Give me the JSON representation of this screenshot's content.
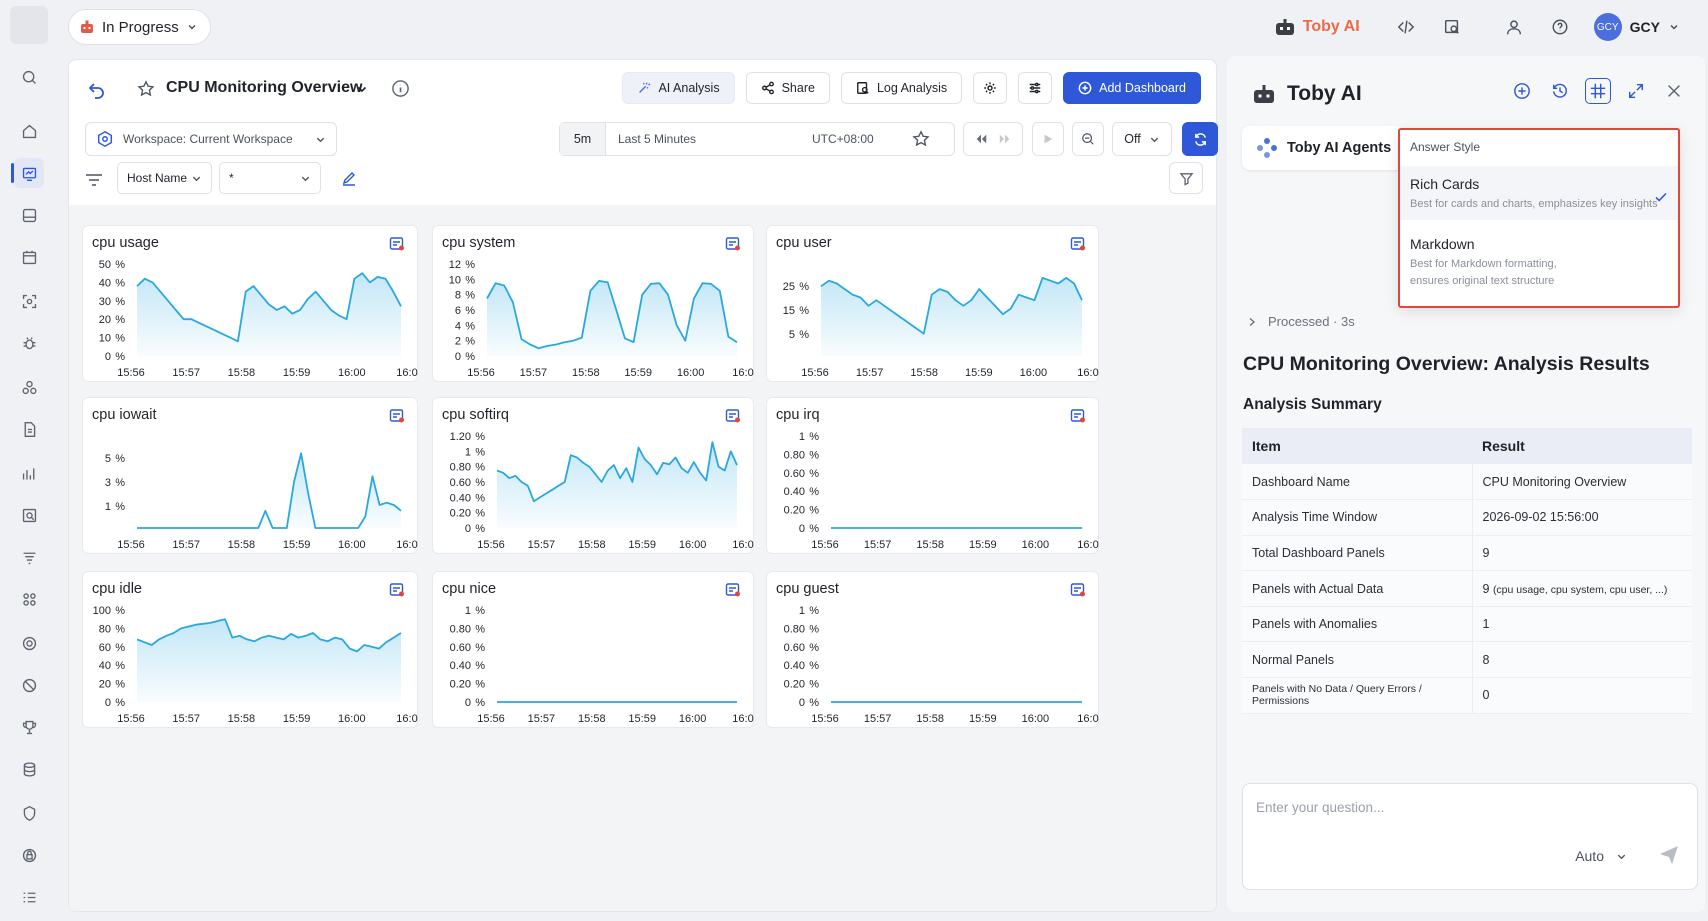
{
  "topbar": {
    "status_label": "In Progress",
    "brand": "Toby AI",
    "user_initials": "GCY",
    "user_name": "GCY"
  },
  "dashboard": {
    "title": "CPU Monitoring Overview",
    "buttons": {
      "ai_analysis": "AI Analysis",
      "share": "Share",
      "log_analysis": "Log Analysis",
      "add_dashboard": "Add Dashboard"
    },
    "workspace": "Workspace: Current Workspace",
    "time": {
      "quick": "5m",
      "range": "Last 5 Minutes",
      "timezone": "UTC+08:00",
      "auto_refresh": "Off"
    },
    "variable": {
      "name": "Host Name",
      "value": "*"
    }
  },
  "colors": {
    "accent": "#2f58d8",
    "series": "#29a8df",
    "brand": "#ea6b45",
    "highlight": "#e0463c"
  },
  "panels": [
    {
      "title": "cpu usage"
    },
    {
      "title": "cpu system"
    },
    {
      "title": "cpu user"
    },
    {
      "title": "cpu iowait"
    },
    {
      "title": "cpu softirq"
    },
    {
      "title": "cpu irq"
    },
    {
      "title": "cpu idle"
    },
    {
      "title": "cpu nice"
    },
    {
      "title": "cpu guest"
    }
  ],
  "chart_data": [
    {
      "type": "area",
      "name": "cpu usage",
      "x": [
        "15:56",
        "15:57",
        "15:58",
        "15:59",
        "16:00",
        "16:0"
      ],
      "y_ticks": [
        "50 %",
        "40 %",
        "30 %",
        "20 %",
        "10 %",
        "0 %"
      ],
      "ylim": [
        0,
        50
      ],
      "values": [
        38,
        42,
        40,
        35,
        30,
        25,
        20,
        20,
        18,
        16,
        14,
        12,
        10,
        8,
        35,
        38,
        33,
        28,
        25,
        27,
        23,
        25,
        31,
        35,
        30,
        25,
        22,
        20,
        42,
        45,
        40,
        43,
        42,
        35,
        27
      ]
    },
    {
      "type": "area",
      "name": "cpu system",
      "x": [
        "15:56",
        "15:57",
        "15:58",
        "15:59",
        "16:00",
        "16:0"
      ],
      "y_ticks": [
        "12 %",
        "10 %",
        "8 %",
        "6 %",
        "4 %",
        "2 %",
        "0 %"
      ],
      "ylim": [
        0,
        12
      ],
      "values": [
        7.5,
        9.5,
        9.2,
        7,
        2.2,
        1.5,
        1,
        1.3,
        1.5,
        1.8,
        2,
        2.4,
        8.5,
        9.8,
        9.6,
        6,
        2.3,
        1.8,
        8,
        9.4,
        9.5,
        8,
        4,
        2,
        7.5,
        9.5,
        9.4,
        8.5,
        2.5,
        1.8
      ]
    },
    {
      "type": "area",
      "name": "cpu user",
      "x": [
        "15:56",
        "15:57",
        "15:58",
        "15:59",
        "16:00",
        "16:0"
      ],
      "y_ticks": [
        "25 %",
        "15 %",
        "5 %"
      ],
      "ylim": [
        0,
        33
      ],
      "values": [
        25,
        27,
        26,
        24,
        22,
        21,
        18,
        20,
        18,
        16,
        14,
        12,
        10,
        8,
        22,
        24,
        23,
        20,
        18,
        20,
        24,
        21,
        18,
        15,
        17,
        22,
        21,
        20,
        28,
        27,
        26,
        28,
        26,
        20
      ]
    },
    {
      "type": "area",
      "name": "cpu iowait",
      "x": [
        "15:56",
        "15:57",
        "15:58",
        "15:59",
        "16:00",
        "16:0"
      ],
      "y_ticks": [
        "5 %",
        "3 %",
        "1 %"
      ],
      "ylim": [
        0,
        8
      ],
      "values": [
        0,
        0,
        0,
        0,
        0,
        0,
        0,
        0,
        0,
        0,
        0,
        0,
        0,
        0,
        0,
        0,
        0,
        0,
        1.5,
        0,
        0,
        0,
        4,
        6.5,
        3,
        0,
        0,
        0,
        0,
        0,
        0,
        0,
        1,
        4.5,
        2,
        2.2,
        2,
        1.5
      ]
    },
    {
      "type": "area",
      "name": "cpu softirq",
      "x": [
        "15:56",
        "15:57",
        "15:58",
        "15:59",
        "16:00",
        "16:0"
      ],
      "y_ticks": [
        "1.20 %",
        "1 %",
        "0.80 %",
        "0.60 %",
        "0.40 %",
        "0.20 %",
        "0 %"
      ],
      "ylim": [
        0,
        1.2
      ],
      "values": [
        0.75,
        0.72,
        0.65,
        0.68,
        0.6,
        0.55,
        0.35,
        0.4,
        0.45,
        0.5,
        0.55,
        0.6,
        0.95,
        0.92,
        0.85,
        0.8,
        0.7,
        0.6,
        0.75,
        0.82,
        0.65,
        0.78,
        0.6,
        1.05,
        0.9,
        0.82,
        0.7,
        0.85,
        0.83,
        0.92,
        0.78,
        0.72,
        0.86,
        0.72,
        0.62,
        1.12,
        0.8,
        0.75,
        1.0,
        0.82
      ]
    },
    {
      "type": "line",
      "name": "cpu irq",
      "x": [
        "15:56",
        "15:57",
        "15:58",
        "15:59",
        "16:00",
        "16:0"
      ],
      "y_ticks": [
        "1 %",
        "0.80 %",
        "0.60 %",
        "0.40 %",
        "0.20 %",
        "0 %"
      ],
      "ylim": [
        0,
        1
      ],
      "values": [
        0,
        0
      ]
    },
    {
      "type": "area",
      "name": "cpu idle",
      "x": [
        "15:56",
        "15:57",
        "15:58",
        "15:59",
        "16:00",
        "16:0"
      ],
      "y_ticks": [
        "100 %",
        "80 %",
        "60 %",
        "40 %",
        "20 %",
        "0 %"
      ],
      "ylim": [
        0,
        100
      ],
      "values": [
        68,
        65,
        62,
        68,
        72,
        75,
        80,
        82,
        84,
        85,
        86,
        88,
        90,
        70,
        72,
        68,
        66,
        70,
        72,
        70,
        68,
        74,
        70,
        72,
        75,
        68,
        66,
        70,
        68,
        58,
        55,
        62,
        60,
        58,
        65,
        70,
        75
      ]
    },
    {
      "type": "line",
      "name": "cpu nice",
      "x": [
        "15:56",
        "15:57",
        "15:58",
        "15:59",
        "16:00",
        "16:0"
      ],
      "y_ticks": [
        "1 %",
        "0.80 %",
        "0.60 %",
        "0.40 %",
        "0.20 %",
        "0 %"
      ],
      "ylim": [
        0,
        1
      ],
      "values": [
        0,
        0
      ]
    },
    {
      "type": "line",
      "name": "cpu guest",
      "x": [
        "15:56",
        "15:57",
        "15:58",
        "15:59",
        "16:00",
        "16:0"
      ],
      "y_ticks": [
        "1 %",
        "0.80 %",
        "0.60 %",
        "0.40 %",
        "0.20 %",
        "0 %"
      ],
      "ylim": [
        0,
        1
      ],
      "values": [
        0,
        0
      ]
    }
  ],
  "ai": {
    "title": "Toby AI",
    "agents_label": "Toby AI Agents",
    "answer_style": {
      "label": "Answer Style",
      "options": [
        {
          "name": "Rich Cards",
          "desc": "Best for cards and charts, emphasizes key insights",
          "selected": true
        },
        {
          "name": "Markdown",
          "desc1": "Best for Markdown formatting,",
          "desc2": "ensures original text structure",
          "selected": false
        }
      ]
    },
    "processed": "Processed · 3s",
    "result_title": "CPU Monitoring Overview: Analysis Results",
    "summary_title": "Analysis Summary",
    "table_headers": {
      "item": "Item",
      "result": "Result"
    },
    "rows": [
      {
        "item": "Dashboard Name",
        "result": "CPU Monitoring Overview"
      },
      {
        "item": "Analysis Time Window",
        "result": "2026-09-02 15:56:00"
      },
      {
        "item": "Total Dashboard Panels",
        "result": "9"
      },
      {
        "item": "Panels with Actual Data",
        "result": "9",
        "note": "(cpu usage, cpu system, cpu user, ...)"
      },
      {
        "item": "Panels with Anomalies",
        "result": "1"
      },
      {
        "item": "Normal Panels",
        "result": "8"
      },
      {
        "item": "Panels with No Data / Query Errors / Permissions",
        "result": "0"
      }
    ],
    "input_placeholder": "Enter your question...",
    "model": "Auto"
  }
}
